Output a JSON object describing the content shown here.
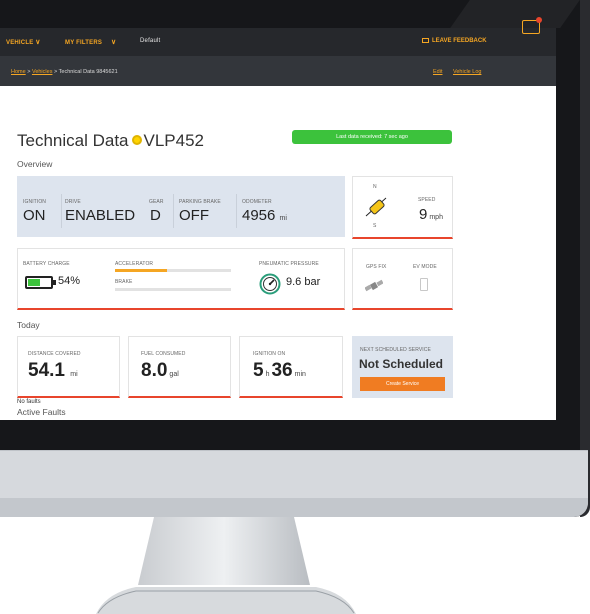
{
  "topbar": {
    "vehicle_label": "VEHICLE",
    "filters_label": "MY FILTERS",
    "default_label": "Default",
    "feedback_label": "LEAVE FEEDBACK"
  },
  "breadcrumb": {
    "home": "Home",
    "separator1": ">",
    "vehicles": "Vehicles",
    "separator2": ">",
    "current": "Technical Data 9845621",
    "edit": "Edit",
    "vehicle_log": "Vehicle Log"
  },
  "page": {
    "title": "Technical Data",
    "vehicle_id": "VLP452",
    "last_data": "Last data received: 7 sec ago",
    "overview_heading": "Overview",
    "today_heading": "Today",
    "faults_heading": "Active Faults",
    "faults_text": "No faults"
  },
  "overview": {
    "ignition": {
      "label": "IGNITION",
      "value": "ON"
    },
    "drive": {
      "label": "DRIVE",
      "value": "ENABLED"
    },
    "gear": {
      "label": "GEAR",
      "value": "D"
    },
    "parking_brake": {
      "label": "PARKING BRAKE",
      "value": "OFF"
    },
    "odometer": {
      "label": "ODOMETER",
      "value": "4956",
      "unit": "mi"
    },
    "compass": {
      "north": "N",
      "south": "S"
    },
    "speed": {
      "label": "SPEED",
      "value": "9",
      "unit": "mph"
    },
    "battery": {
      "label": "BATTERY CHARGE",
      "value": "54%",
      "level": 0.54
    },
    "accelerator": {
      "label": "ACCELERATOR",
      "level": 0.45
    },
    "brake": {
      "label": "BRAKE",
      "level": 0.0
    },
    "pneumatic": {
      "label": "PNEUMATIC PRESSURE",
      "value": "9.6 bar"
    },
    "gps": {
      "label": "GPS FIX"
    },
    "ev": {
      "label": "EV MODE"
    }
  },
  "today": {
    "distance": {
      "label": "DISTANCE COVERED",
      "value": "54.1",
      "unit": "mi"
    },
    "fuel": {
      "label": "FUEL CONSUMED",
      "value": "8.0",
      "unit": "gal"
    },
    "ignition_on": {
      "label": "IGNITION ON",
      "hours": "5",
      "hours_unit": "h",
      "minutes": "36",
      "minutes_unit": "min"
    },
    "service": {
      "label": "NEXT SCHEDULED SERVICE",
      "value": "Not Scheduled",
      "button": "Create Service"
    }
  },
  "colors": {
    "accent": "#f5a623",
    "alert": "#e8452c",
    "online": "#3cc23c",
    "battery": "#3cc23c"
  },
  "icons": {
    "compass": "compass-icon",
    "gauge": "gauge-icon",
    "satellite": "satellite-icon",
    "battery": "battery-icon",
    "ev": "ev-plug-icon",
    "feedback": "feedback-icon",
    "notifications": "notification-icon"
  }
}
